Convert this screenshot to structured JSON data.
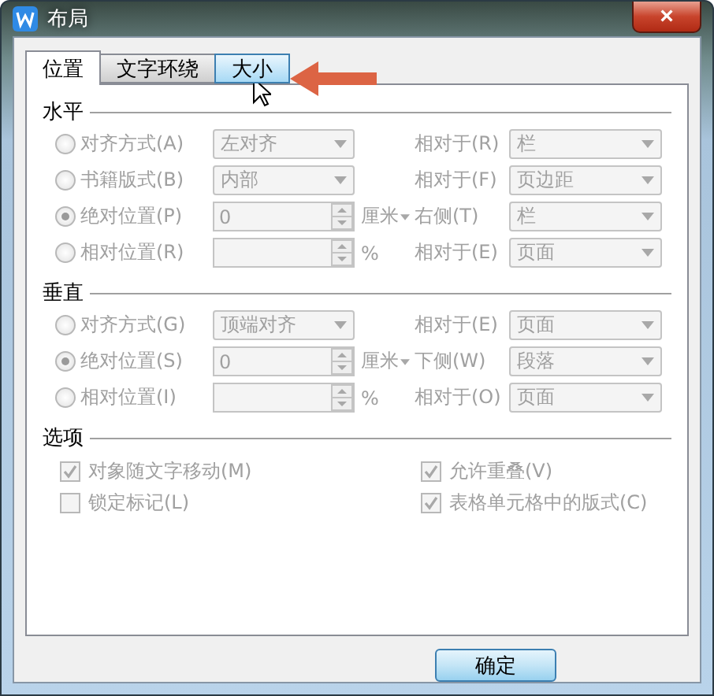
{
  "window": {
    "title": "布局",
    "close_label": "×"
  },
  "tabs": [
    {
      "label": "位置",
      "selected": true,
      "hovered": false
    },
    {
      "label": "文字环绕",
      "selected": false,
      "hovered": false
    },
    {
      "label": "大小",
      "selected": false,
      "hovered": true
    }
  ],
  "sections": [
    {
      "title": "水平",
      "rows": [
        {
          "kind": "select",
          "label": "对齐方式(A)",
          "selected": false,
          "disabled": true,
          "value": "左对齐",
          "relative_label": "相对于(R)",
          "relative_value": "栏"
        },
        {
          "kind": "select",
          "label": "书籍版式(B)",
          "selected": false,
          "disabled": true,
          "value": "内部",
          "relative_label": "相对于(F)",
          "relative_value": "页边距"
        },
        {
          "kind": "spin",
          "label": "绝对位置(P)",
          "selected": true,
          "disabled": true,
          "value": "0",
          "unit": "厘米",
          "unit_dropdown": true,
          "relative_label": "右侧(T)",
          "relative_value": "栏"
        },
        {
          "kind": "spin",
          "label": "相对位置(R)",
          "selected": false,
          "disabled": true,
          "value": "",
          "unit": "%",
          "unit_dropdown": false,
          "relative_label": "相对于(E)",
          "relative_value": "页面"
        }
      ]
    },
    {
      "title": "垂直",
      "rows": [
        {
          "kind": "select",
          "label": "对齐方式(G)",
          "selected": false,
          "disabled": true,
          "value": "顶端对齐",
          "relative_label": "相对于(E)",
          "relative_value": "页面"
        },
        {
          "kind": "spin",
          "label": "绝对位置(S)",
          "selected": true,
          "disabled": true,
          "value": "0",
          "unit": "厘米",
          "unit_dropdown": true,
          "relative_label": "下侧(W)",
          "relative_value": "段落"
        },
        {
          "kind": "spin",
          "label": "相对位置(I)",
          "selected": false,
          "disabled": true,
          "value": "",
          "unit": "%",
          "unit_dropdown": false,
          "relative_label": "相对于(O)",
          "relative_value": "页面"
        }
      ]
    }
  ],
  "options": {
    "title": "选项",
    "items": [
      {
        "label": "对象随文字移动(M)",
        "checked": true,
        "disabled": true
      },
      {
        "label": "允许重叠(V)",
        "checked": true,
        "disabled": true
      },
      {
        "label": "锁定标记(L)",
        "checked": false,
        "disabled": true
      },
      {
        "label": "表格单元格中的版式(C)",
        "checked": true,
        "disabled": true
      }
    ]
  },
  "buttons": [
    {
      "label": "确定"
    }
  ]
}
